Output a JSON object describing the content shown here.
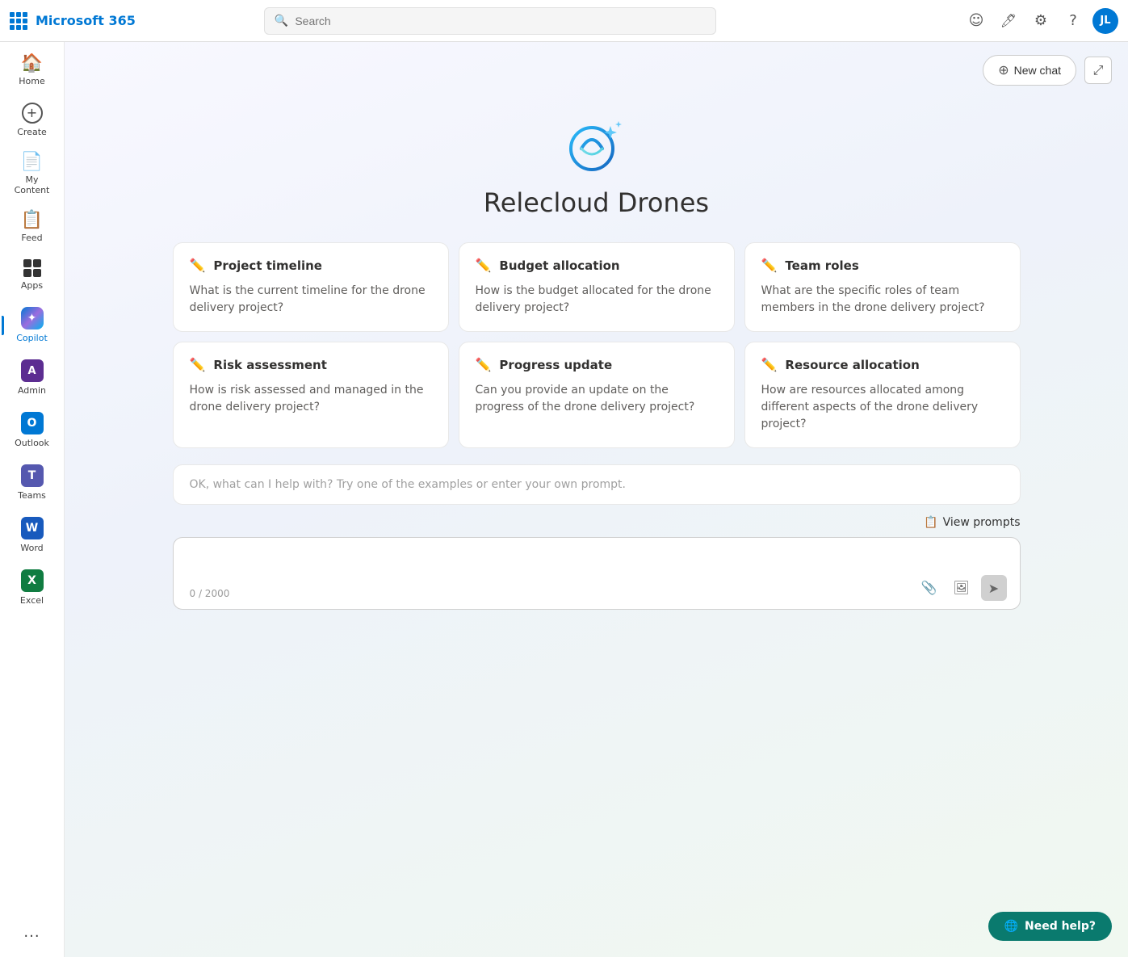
{
  "topbar": {
    "logo": "Microsoft 365",
    "search_placeholder": "Search",
    "icons": [
      "emoji",
      "feedback",
      "settings",
      "help"
    ],
    "avatar_initials": "JL",
    "new_chat_label": "New chat"
  },
  "sidebar": {
    "items": [
      {
        "id": "home",
        "label": "Home",
        "icon": "🏠"
      },
      {
        "id": "create",
        "label": "Create",
        "icon": "➕"
      },
      {
        "id": "my-content",
        "label": "My Content",
        "icon": "📄"
      },
      {
        "id": "feed",
        "label": "Feed",
        "icon": "📋"
      },
      {
        "id": "apps",
        "label": "Apps",
        "icon": "⊞"
      },
      {
        "id": "copilot",
        "label": "Copilot",
        "icon": "copilot",
        "active": true
      },
      {
        "id": "admin",
        "label": "Admin",
        "icon": "admin"
      },
      {
        "id": "outlook",
        "label": "Outlook",
        "icon": "O",
        "color": "outlook"
      },
      {
        "id": "teams",
        "label": "Teams",
        "icon": "T",
        "color": "teams"
      },
      {
        "id": "word",
        "label": "Word",
        "icon": "W",
        "color": "word"
      },
      {
        "id": "excel",
        "label": "Excel",
        "icon": "X",
        "color": "excel"
      },
      {
        "id": "more",
        "label": "More",
        "icon": "···"
      }
    ]
  },
  "copilot": {
    "title": "Relecloud Drones",
    "new_chat_label": "New chat",
    "view_prompts_label": "View prompts",
    "input_placeholder": "OK, what can I help with? Try one of the examples or enter your own prompt.",
    "input_counter": "0 / 2000",
    "cards": [
      {
        "id": "project-timeline",
        "title": "Project timeline",
        "body": "What is the current timeline for the drone delivery project?"
      },
      {
        "id": "budget-allocation",
        "title": "Budget allocation",
        "body": "How is the budget allocated for the drone delivery project?"
      },
      {
        "id": "team-roles",
        "title": "Team roles",
        "body": "What are the specific roles of team members in the drone delivery project?"
      },
      {
        "id": "risk-assessment",
        "title": "Risk assessment",
        "body": "How is risk assessed and managed in the drone delivery project?"
      },
      {
        "id": "progress-update",
        "title": "Progress update",
        "body": "Can you provide an update on the progress of the drone delivery project?"
      },
      {
        "id": "resource-allocation",
        "title": "Resource allocation",
        "body": "How are resources allocated among different aspects of the drone delivery project?"
      }
    ],
    "need_help_label": "Need help?"
  }
}
